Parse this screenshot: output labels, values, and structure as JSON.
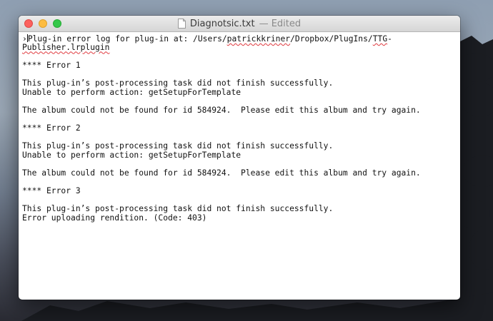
{
  "window": {
    "title": "Diagnotsic.txt",
    "title_suffix": "— Edited"
  },
  "document": {
    "line1_marker": "›",
    "line1_text": "Plug-in error log for plug-in at: /Users/",
    "line1_misspelled_1": "patrickkriner",
    "line1_mid": "/Dropbox/PlugIns/",
    "line1_misspelled_2": "TTG",
    "line1_end": "-",
    "line2_misspelled": "Publisher.lrplugin",
    "errors": [
      {
        "header": "**** Error 1",
        "line_a": "This plug-in’s post-processing task did not finish successfully.",
        "line_b": "Unable to perform action: getSetupForTemplate",
        "line_c": "The album could not be found for id 584924.  Please edit this album and try again."
      },
      {
        "header": "**** Error 2",
        "line_a": "This plug-in’s post-processing task did not finish successfully.",
        "line_b": "Unable to perform action: getSetupForTemplate",
        "line_c": "The album could not be found for id 584924.  Please edit this album and try again."
      },
      {
        "header": "**** Error 3",
        "line_a": "This plug-in’s post-processing task did not finish successfully.",
        "line_b": "Error uploading rendition. (Code: 403)"
      }
    ]
  }
}
